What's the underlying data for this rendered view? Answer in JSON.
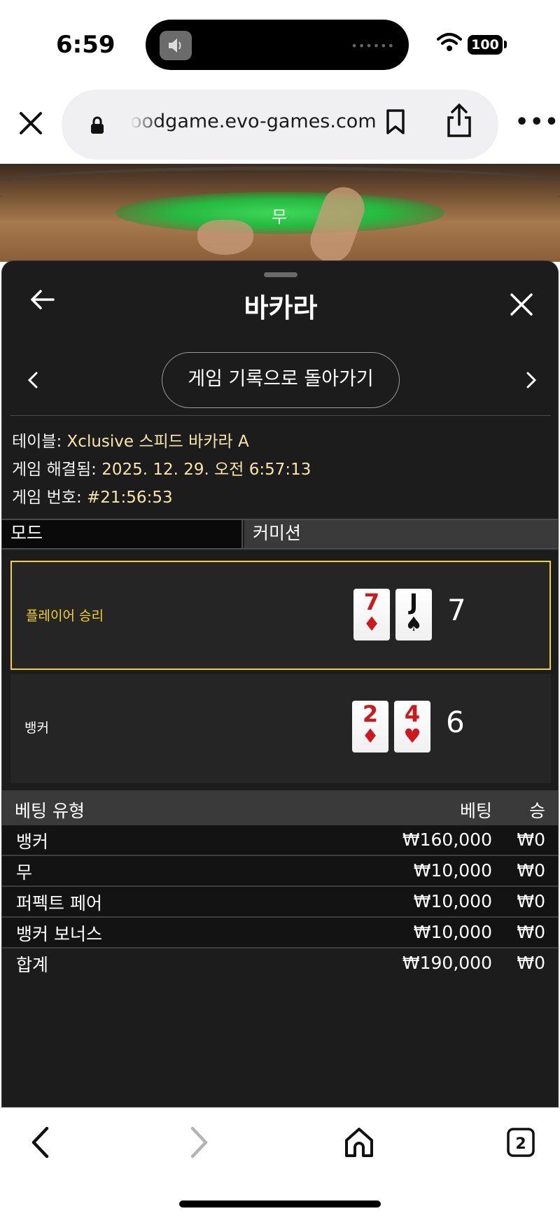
{
  "status_bar": {
    "time": "6:59",
    "battery": "100"
  },
  "browser": {
    "url": "oodgame.evo-games.com",
    "tab_count": "2"
  },
  "video": {
    "overlay_label": "무"
  },
  "sheet": {
    "title": "바카라",
    "back_to_history": "게임 기록으로 돌아가기",
    "info": {
      "table_label": "테이블:",
      "table_value": "Xclusive 스피드 바카라 A",
      "resolved_label": "게임 해결됨:",
      "resolved_value": "2025. 12. 29. 오전 6:57:13",
      "number_label": "게임 번호:",
      "number_value": "#21:56:53"
    },
    "mode_label": "모드",
    "commission_label": "커미션",
    "player": {
      "label": "플레이어 승리",
      "cards": [
        {
          "rank": "7",
          "suit": "♦"
        },
        {
          "rank": "J",
          "suit": "♠"
        }
      ],
      "score": "7"
    },
    "banker": {
      "label": "뱅커",
      "cards": [
        {
          "rank": "2",
          "suit": "♦"
        },
        {
          "rank": "4",
          "suit": "♥"
        }
      ],
      "score": "6"
    },
    "bets": {
      "headers": [
        "베팅 유형",
        "베팅",
        "승"
      ],
      "rows": [
        [
          "뱅커",
          "₩160,000",
          "₩0"
        ],
        [
          "무",
          "₩10,000",
          "₩0"
        ],
        [
          "퍼펙트 페어",
          "₩10,000",
          "₩0"
        ],
        [
          "뱅커 보너스",
          "₩10,000",
          "₩0"
        ]
      ],
      "total": [
        "합계",
        "₩190,000",
        "₩0"
      ]
    }
  },
  "colors": {
    "win_highlight": "#f2d41c",
    "sheet_bg": "#1c1c1c",
    "card_red": "#d0181c"
  }
}
